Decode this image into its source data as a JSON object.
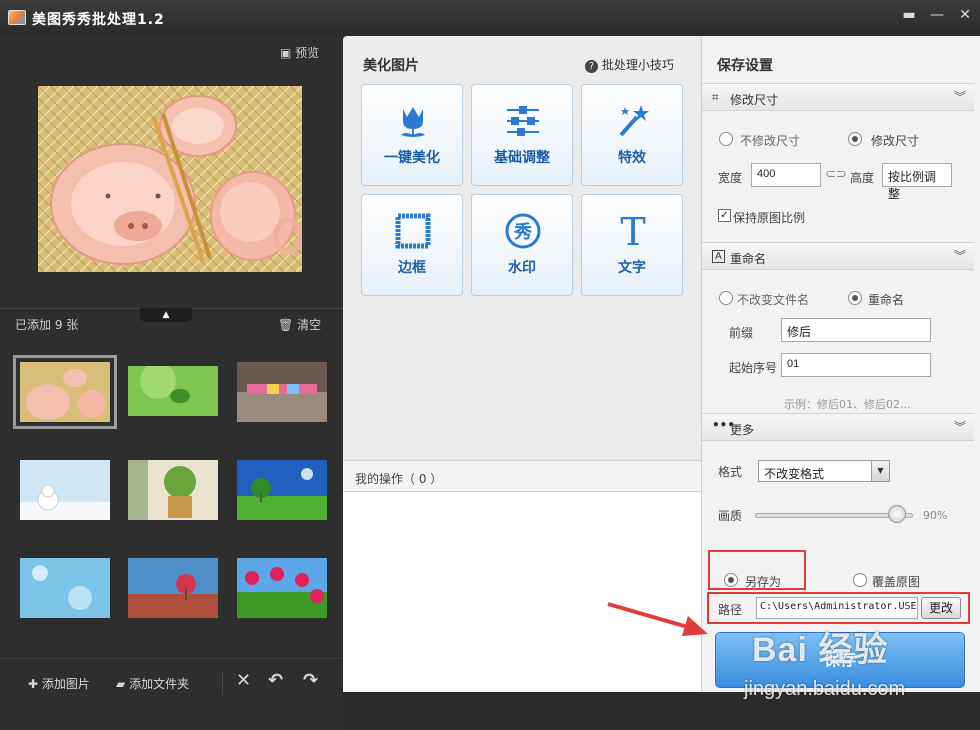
{
  "window": {
    "title": "美图秀秀批处理1.2",
    "controls": [
      "chat-icon",
      "minimize-icon",
      "close-icon"
    ]
  },
  "left": {
    "preview_label": "预览",
    "added_label": "已添加 9 张",
    "clear_label": "清空",
    "footer": {
      "add_image": "添加图片",
      "add_folder": "添加文件夹"
    }
  },
  "middle": {
    "title": "美化图片",
    "tips": "批处理小技巧",
    "tools": [
      {
        "label": "一键美化",
        "icon": "tulip-icon"
      },
      {
        "label": "基础调整",
        "icon": "sliders-icon"
      },
      {
        "label": "特效",
        "icon": "magic-wand-icon"
      },
      {
        "label": "边框",
        "icon": "frame-icon"
      },
      {
        "label": "水印",
        "icon": "watermark-icon"
      },
      {
        "label": "文字",
        "icon": "text-icon"
      }
    ],
    "tool_icon_glyphs": {
      "watermark": "秀",
      "text": "T"
    },
    "ops_title": "我的操作（ 0 ）"
  },
  "right": {
    "title": "保存设置",
    "resize": {
      "header": "修改尺寸",
      "opt_keep": "不修改尺寸",
      "opt_resize": "修改尺寸",
      "width_label": "宽度",
      "width_value": "400",
      "height_label": "高度",
      "height_value": "按比例调整",
      "keep_ratio": "保持原图比例"
    },
    "rename": {
      "header": "重命名",
      "header_icon_glyph": "A",
      "opt_keep": "不改变文件名",
      "opt_rename": "重命名",
      "prefix_label": "前缀",
      "prefix_value": "修后",
      "start_label": "起始序号",
      "start_value": "01",
      "example": "示例：修后01、修后02..."
    },
    "more": {
      "header": "更多",
      "format_label": "格式",
      "format_value": "不改变格式",
      "quality_label": "画质",
      "quality_value": "90%",
      "quality": 0.9,
      "save_as": "另存为",
      "overwrite": "覆盖原图",
      "path_label": "路径",
      "path_value": "C:\\Users\\Administrator.USE",
      "change": "更改"
    },
    "save": "保存"
  },
  "watermark": {
    "logo": "Bai 经验",
    "url": "jingyan.baidu.com"
  },
  "colors": {
    "accent": "#3a8ee0",
    "highlight": "#e23b3b",
    "dark_bg": "#2e2e2e"
  }
}
